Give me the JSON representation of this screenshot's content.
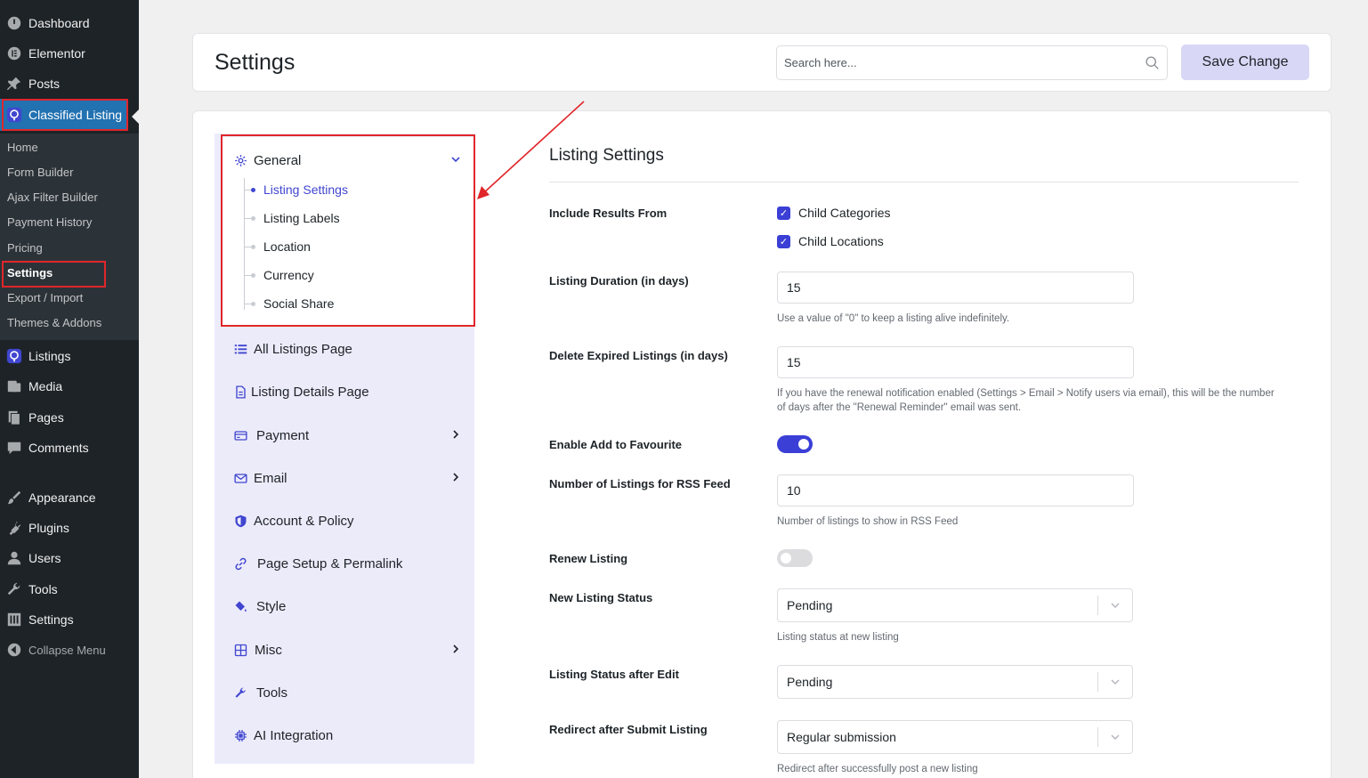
{
  "wp_menu": {
    "items": [
      {
        "label": "Dashboard",
        "icon": "dashboard-icon"
      },
      {
        "label": "Elementor",
        "icon": "elementor-icon"
      },
      {
        "label": "Posts",
        "icon": "pin-icon"
      },
      {
        "label": "Classified Listing",
        "icon": "classified-listing-icon"
      },
      {
        "label": "Listings",
        "icon": "classified-listing-icon"
      },
      {
        "label": "Media",
        "icon": "media-icon"
      },
      {
        "label": "Pages",
        "icon": "pages-icon"
      },
      {
        "label": "Comments",
        "icon": "comments-icon"
      },
      {
        "label": "Appearance",
        "icon": "brush-icon"
      },
      {
        "label": "Plugins",
        "icon": "plugin-icon"
      },
      {
        "label": "Users",
        "icon": "user-icon"
      },
      {
        "label": "Tools",
        "icon": "wrench-icon"
      },
      {
        "label": "Settings",
        "icon": "settings-icon"
      },
      {
        "label": "Collapse Menu",
        "icon": "collapse-icon"
      }
    ],
    "submenu": [
      "Home",
      "Form Builder",
      "Ajax Filter Builder",
      "Payment History",
      "Pricing",
      "Settings",
      "Export / Import",
      "Themes & Addons"
    ]
  },
  "header": {
    "title": "Settings",
    "search_placeholder": "Search here...",
    "save_label": "Save Change"
  },
  "settings_nav": {
    "general": {
      "label": "General",
      "children": [
        "Listing Settings",
        "Listing Labels",
        "Location",
        "Currency",
        "Social Share"
      ]
    },
    "items": [
      {
        "label": "All Listings Page",
        "icon": "list-icon"
      },
      {
        "label": "Listing Details Page",
        "icon": "document-icon"
      },
      {
        "label": "Payment",
        "icon": "credit-card-icon"
      },
      {
        "label": "Email",
        "icon": "envelope-icon"
      },
      {
        "label": "Account & Policy",
        "icon": "shield-icon"
      },
      {
        "label": "Page Setup & Permalink",
        "icon": "link-icon"
      },
      {
        "label": "Style",
        "icon": "paint-bucket-icon"
      },
      {
        "label": "Misc",
        "icon": "grid-icon"
      },
      {
        "label": "Tools",
        "icon": "wrench-icon"
      },
      {
        "label": "AI Integration",
        "icon": "chip-icon"
      }
    ]
  },
  "content": {
    "heading": "Listing Settings",
    "include_results": {
      "label": "Include Results From",
      "options": [
        "Child Categories",
        "Child Locations"
      ]
    },
    "duration": {
      "label": "Listing Duration (in days)",
      "value": "15",
      "help": "Use a value of \"0\" to keep a listing alive indefinitely."
    },
    "delete_expired": {
      "label": "Delete Expired Listings (in days)",
      "value": "15",
      "help_line1": "If you have the renewal notification enabled (Settings > Email > Notify users via email), this will be the number",
      "help_line2": "of days after the \"Renewal Reminder\" email was sent."
    },
    "favourite": {
      "label": "Enable Add to Favourite",
      "on": true
    },
    "rss": {
      "label": "Number of Listings for RSS Feed",
      "value": "10",
      "help": "Number of listings to show in RSS Feed"
    },
    "renew": {
      "label": "Renew Listing",
      "on": false
    },
    "new_status": {
      "label": "New Listing Status",
      "value": "Pending",
      "help": "Listing status at new listing"
    },
    "after_edit": {
      "label": "Listing Status after Edit",
      "value": "Pending"
    },
    "redirect": {
      "label": "Redirect after Submit Listing",
      "value": "Regular submission",
      "help": "Redirect after successfully post a new listing"
    }
  },
  "colors": {
    "accent": "#3b3fd6",
    "wp_sidebar": "#1d2327",
    "wp_active": "#2271b1",
    "highlight_box": "#e0262b"
  }
}
